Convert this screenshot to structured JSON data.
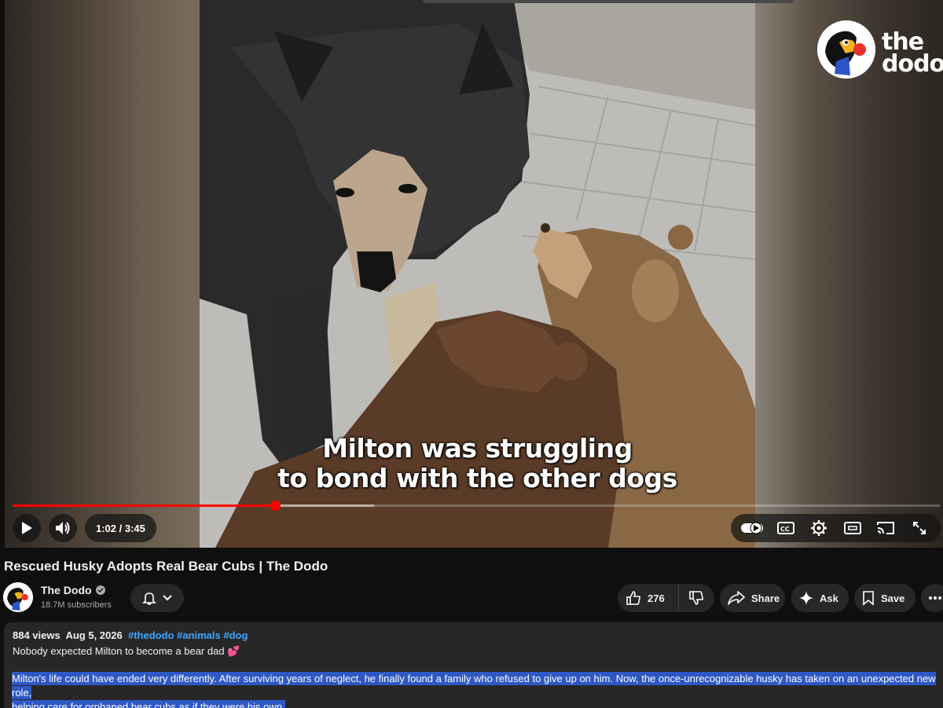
{
  "player": {
    "caption_line1": "Milton was struggling",
    "caption_line2": "to bond with the other dogs",
    "logo_text_line1": "the",
    "logo_text_line2": "dodo",
    "time": "1:02 / 3:45",
    "progress_played_fraction": 0.283,
    "progress_buffered_fraction": 0.39,
    "colors": {
      "progress": "#ff0000",
      "buffer": "#8a8a8a"
    },
    "controls": [
      "play-icon",
      "volume-icon",
      "autoplay-toggle-icon",
      "captions-icon",
      "settings-icon",
      "theater-mode-icon",
      "cast-icon",
      "fullscreen-icon"
    ]
  },
  "video": {
    "title": "Rescued Husky Adopts Real Bear Cubs | The Dodo"
  },
  "channel": {
    "name": "The Dodo",
    "subscribers": "18.7M subscribers"
  },
  "actions": {
    "like_count": "276",
    "share_label": "Share",
    "ask_label": "Ask",
    "save_label": "Save"
  },
  "description": {
    "views": "884 views",
    "date": "Aug 5, 2026",
    "tags": [
      "#thedodo",
      "#animals",
      "#dog"
    ],
    "hook": "Nobody expected Milton to become a bear dad 💕",
    "body_line1": "Milton's life could have ended very differently. After surviving years of neglect, he finally found a family who refused to give up on him. Now, the once-unrecognizable husky has taken on an unexpected new role,",
    "body_line2": "helping care for orphaned bear cubs as if they were his own.",
    "highlight_color": "#2e58c5",
    "link_color": "#3ea6ff"
  }
}
